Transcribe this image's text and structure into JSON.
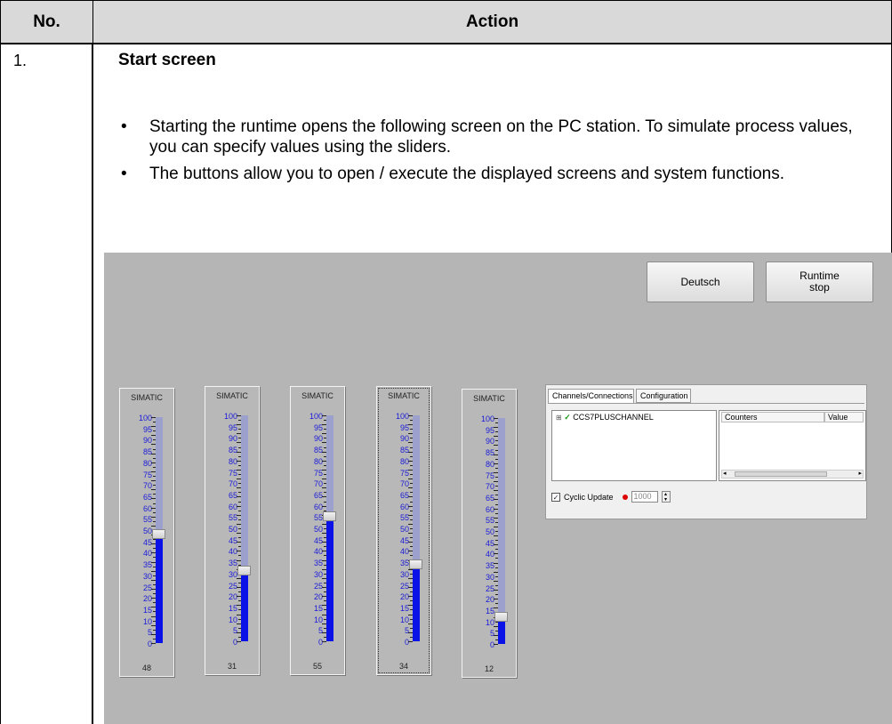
{
  "table": {
    "header_no": "No.",
    "header_action": "Action",
    "row_number": "1.",
    "step_title": "Start screen",
    "bullets": [
      "Starting the runtime opens the following screen on the PC station. To simulate process values, you can specify values using the sliders.",
      "The buttons allow you to open / execute the displayed screens and system functions."
    ]
  },
  "screenshot": {
    "buttons": {
      "deutsch": "Deutsch",
      "runtime_stop": "Runtime stop"
    },
    "sliders": [
      {
        "title": "SIMATIC",
        "value": 48
      },
      {
        "title": "SIMATIC",
        "value": 31
      },
      {
        "title": "SIMATIC",
        "value": 55
      },
      {
        "title": "SIMATIC",
        "value": 34
      },
      {
        "title": "SIMATIC",
        "value": 12
      }
    ],
    "slider_scale": [
      "100",
      "95",
      "90",
      "85",
      "80",
      "75",
      "70",
      "65",
      "60",
      "55",
      "50",
      "45",
      "40",
      "35",
      "30",
      "25",
      "20",
      "15",
      "10",
      "5",
      "0"
    ],
    "channel_panel": {
      "tabs": [
        "Channels/Connections",
        "Configuration"
      ],
      "tree_item": "CCS7PLUSCHANNEL",
      "list_columns": [
        "Counters",
        "Value"
      ],
      "cyclic_update_label": "Cyclic Update",
      "cyclic_update_checked": true,
      "interval_value": "1000"
    }
  }
}
